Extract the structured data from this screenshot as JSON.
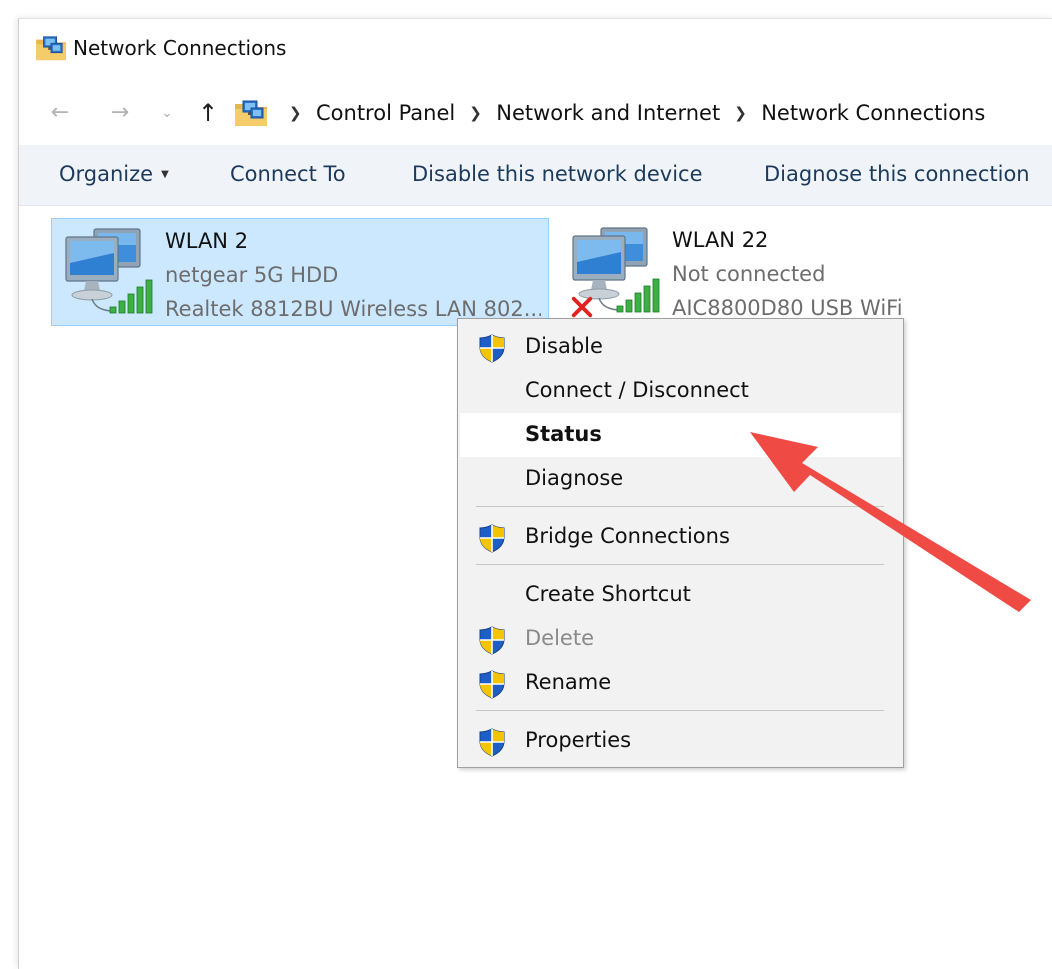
{
  "window": {
    "title": "Network Connections",
    "title_icon": "network-connections-folder-icon"
  },
  "address_bar": {
    "back_icon": "back-arrow-icon",
    "forward_icon": "forward-arrow-icon",
    "recent_icon": "chevron-down-icon",
    "up_icon": "up-arrow-icon",
    "location_icon": "network-connections-folder-icon",
    "breadcrumbs": [
      "Control Panel",
      "Network and Internet",
      "Network Connections"
    ]
  },
  "command_bar": {
    "organize": "Organize",
    "connect_to": "Connect To",
    "disable": "Disable this network device",
    "diagnose": "Diagnose this connection"
  },
  "connections": [
    {
      "name": "WLAN 2",
      "status": "netgear 5G HDD",
      "device": "Realtek 8812BU Wireless LAN 802...",
      "selected": true,
      "signal": "full"
    },
    {
      "name": "WLAN 22",
      "status": "Not connected",
      "device": "AIC8800D80 USB WiFi",
      "selected": false,
      "signal": "disconnected"
    }
  ],
  "context_menu": {
    "items": [
      {
        "label": "Disable",
        "shield": true
      },
      {
        "label": "Connect / Disconnect",
        "shield": false
      },
      {
        "label": "Status",
        "shield": false,
        "bold": true,
        "highlighted": true
      },
      {
        "label": "Diagnose",
        "shield": false
      },
      {
        "label": "Bridge Connections",
        "shield": true
      },
      {
        "label": "Create Shortcut",
        "shield": false
      },
      {
        "label": "Delete",
        "shield": true,
        "disabled": true
      },
      {
        "label": "Rename",
        "shield": true
      },
      {
        "label": "Properties",
        "shield": true
      }
    ]
  },
  "annotation": {
    "arrow_color": "#f04a45",
    "points_to": "Status"
  },
  "colors": {
    "selection_fill": "#cce8ff",
    "selection_border": "#99d1ff",
    "command_bar_bg": "#f0f4f9",
    "menu_bg": "#f2f2f2",
    "signal_green": "#3cb043"
  }
}
